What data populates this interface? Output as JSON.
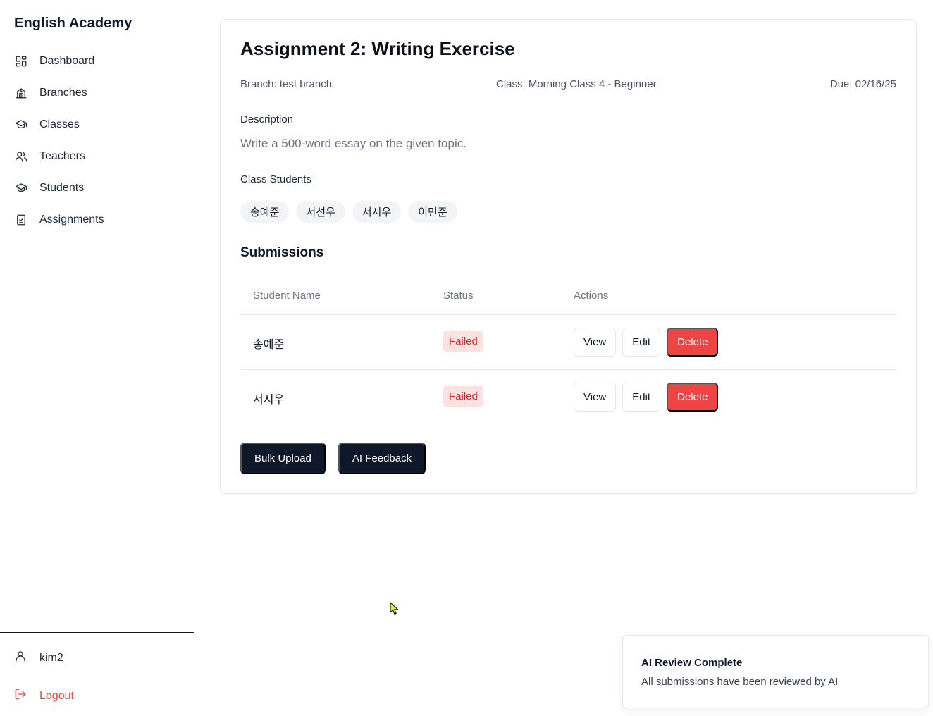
{
  "app": {
    "name": "English Academy"
  },
  "sidebar": {
    "items": [
      {
        "label": "Dashboard",
        "icon": "dashboard-icon"
      },
      {
        "label": "Branches",
        "icon": "building-icon"
      },
      {
        "label": "Classes",
        "icon": "graduation-cap-icon"
      },
      {
        "label": "Teachers",
        "icon": "users-icon"
      },
      {
        "label": "Students",
        "icon": "graduation-cap-icon"
      },
      {
        "label": "Assignments",
        "icon": "clipboard-check-icon"
      }
    ],
    "user": {
      "name": "kim2",
      "icon": "user-icon"
    },
    "logout": {
      "label": "Logout",
      "icon": "logout-icon",
      "color": "#ef4444"
    }
  },
  "assignment": {
    "title": "Assignment 2: Writing Exercise",
    "branch": "Branch: test branch",
    "class": "Class: Morning Class 4 - Beginner",
    "due": "Due: 02/16/25",
    "description_label": "Description",
    "description": "Write a 500-word essay on the given topic.",
    "students_label": "Class Students",
    "students": [
      "송예준",
      "서선우",
      "서시우",
      "이민준"
    ]
  },
  "submissions": {
    "title": "Submissions",
    "columns": [
      "Student Name",
      "Status",
      "Actions"
    ],
    "rows": [
      {
        "name": "송예준",
        "status": "Failed",
        "actions": [
          "View",
          "Edit",
          "Delete"
        ]
      },
      {
        "name": "서시우",
        "status": "Failed",
        "actions": [
          "View",
          "Edit",
          "Delete"
        ]
      }
    ]
  },
  "buttons": {
    "bulk_upload": "Bulk Upload",
    "ai_feedback": "AI Feedback"
  },
  "toast": {
    "title": "AI Review Complete",
    "message": "All submissions have been reviewed by AI"
  },
  "colors": {
    "danger": "#ef4444",
    "primary_dark": "#0f172a",
    "badge_bg": "#fde2e2",
    "badge_text": "#dc2626"
  }
}
